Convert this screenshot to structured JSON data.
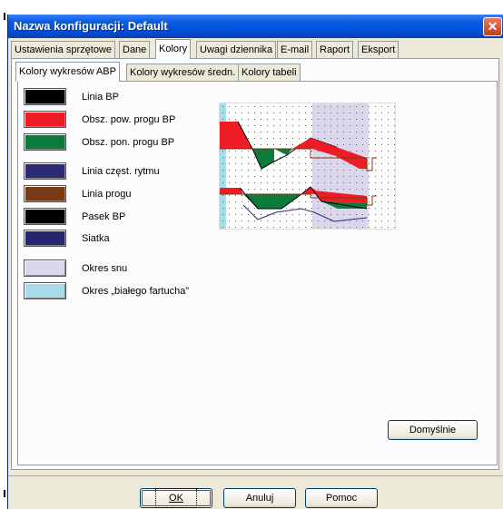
{
  "window": {
    "title": "Nazwa konfiguracji: Default"
  },
  "tabs": [
    {
      "label": "Ustawienia sprzętowe"
    },
    {
      "label": "Dane"
    },
    {
      "label": "Kolory"
    },
    {
      "label": "Uwagi dziennika"
    },
    {
      "label": "E-mail"
    },
    {
      "label": "Raport"
    },
    {
      "label": "Eksport"
    }
  ],
  "active_tab": "Kolory",
  "subtabs": [
    {
      "label": "Kolory wykresów ABP"
    },
    {
      "label": "Kolory wykresów średn."
    },
    {
      "label": "Kolory tabeli"
    }
  ],
  "active_subtab": "Kolory wykresów ABP",
  "color_items": [
    {
      "label": "Linia BP",
      "color": "#000000"
    },
    {
      "label": "Obsz. pow. progu BP",
      "color": "#ee1c24"
    },
    {
      "label": "Obsz. pon. progu BP",
      "color": "#0b7a3a"
    },
    {
      "label": "Linia częst. rytmu",
      "color": "#2b2a72"
    },
    {
      "label": "Linia progu",
      "color": "#7a3a15"
    },
    {
      "label": "Pasek BP",
      "color": "#000000"
    },
    {
      "label": "Siatka",
      "color": "#26266e"
    },
    {
      "label": "Okres snu",
      "color": "#dcd6ec"
    },
    {
      "label": "Okres „białego fartucha”",
      "color": "#a8dcea"
    }
  ],
  "buttons": {
    "defaults": "Domyślnie",
    "ok": "OK",
    "cancel": "Anuluj",
    "help": "Pomoc"
  }
}
